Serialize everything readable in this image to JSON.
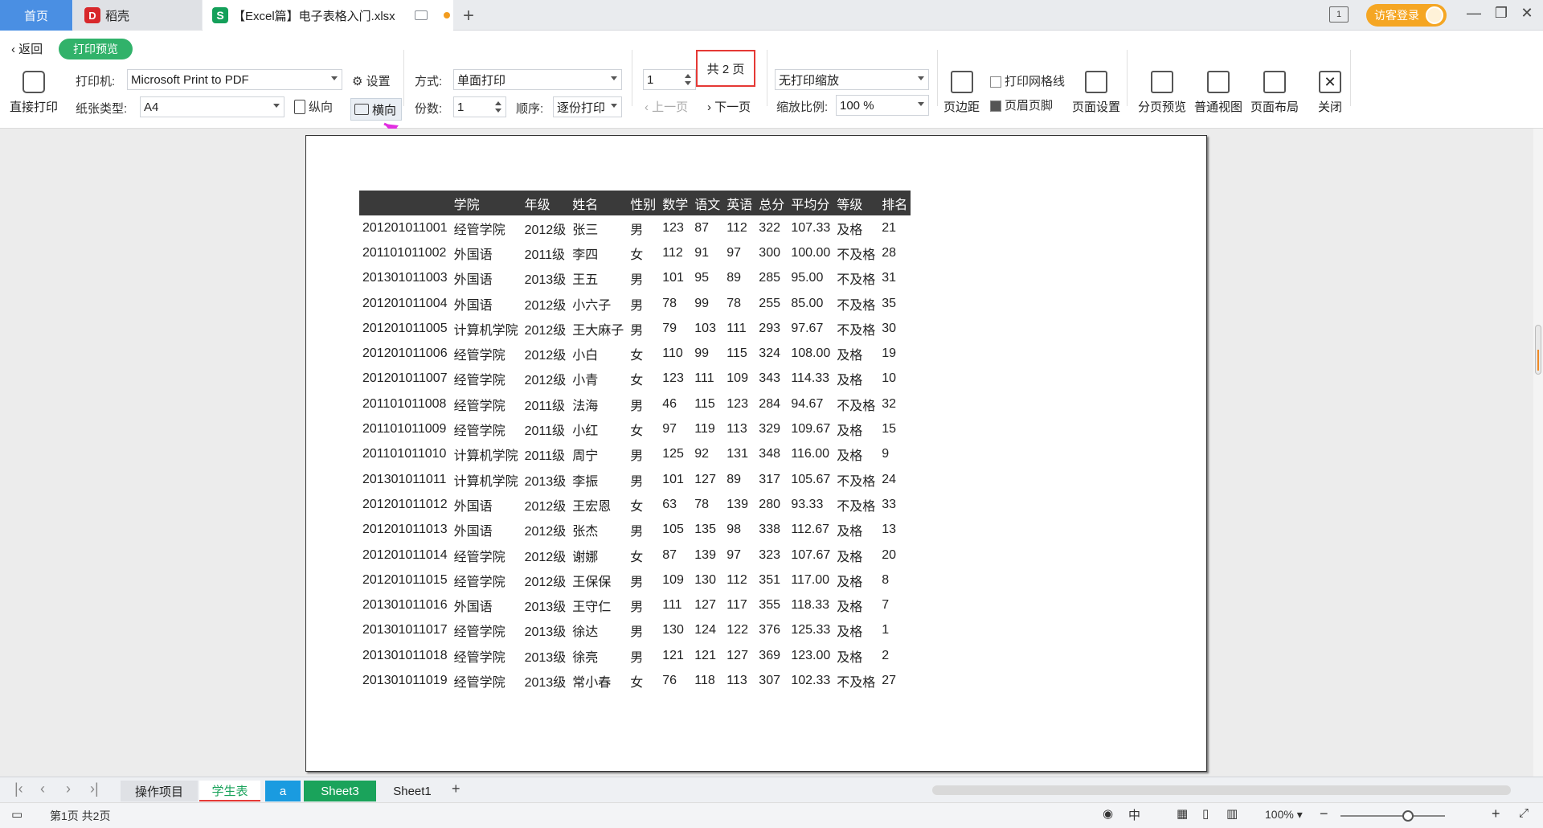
{
  "titlebar": {
    "tabs": [
      {
        "label": "首页"
      },
      {
        "label": "稻壳"
      },
      {
        "label": "【Excel篇】电子表格入门.xlsx"
      }
    ],
    "badge": "1",
    "login": "访客登录"
  },
  "toolbar": {
    "back": "返回",
    "preview": "打印预览",
    "direct_print": "直接打印",
    "printer_label": "打印机:",
    "printer_value": "Microsoft Print to PDF",
    "settings": "设置",
    "paper_label": "纸张类型:",
    "paper_value": "A4",
    "portrait": "纵向",
    "landscape": "横向",
    "mode_label": "方式:",
    "mode_value": "单面打印",
    "copies_label": "份数:",
    "copies_value": "1",
    "order_label": "顺序:",
    "order_value": "逐份打印",
    "page_value": "1",
    "page_count": "共 2 页",
    "prev_page": "上一页",
    "next_page": "下一页",
    "scale_mode": "无打印缩放",
    "scale_label": "缩放比例:",
    "scale_value": "100 %",
    "margins": "页边距",
    "gridlines": "打印网格线",
    "header_footer": "页眉页脚",
    "page_setup": "页面设置",
    "page_break": "分页预览",
    "normal_view": "普通视图",
    "page_layout": "页面布局",
    "close": "关闭"
  },
  "table": {
    "headers": [
      "",
      "学院",
      "年级",
      "姓名",
      "性别",
      "数学",
      "语文",
      "英语",
      "总分",
      "平均分",
      "等级",
      "排名"
    ],
    "rows": [
      [
        "201201011001",
        "经管学院",
        "2012级",
        "张三",
        "男",
        "123",
        "87",
        "112",
        "322",
        "107.33",
        "及格",
        "21"
      ],
      [
        "201101011002",
        "外国语",
        "2011级",
        "李四",
        "女",
        "112",
        "91",
        "97",
        "300",
        "100.00",
        "不及格",
        "28"
      ],
      [
        "201301011003",
        "外国语",
        "2013级",
        "王五",
        "男",
        "101",
        "95",
        "89",
        "285",
        "95.00",
        "不及格",
        "31"
      ],
      [
        "201201011004",
        "外国语",
        "2012级",
        "小六子",
        "男",
        "78",
        "99",
        "78",
        "255",
        "85.00",
        "不及格",
        "35"
      ],
      [
        "201201011005",
        "计算机学院",
        "2012级",
        "王大麻子",
        "男",
        "79",
        "103",
        "111",
        "293",
        "97.67",
        "不及格",
        "30"
      ],
      [
        "201201011006",
        "经管学院",
        "2012级",
        "小白",
        "女",
        "110",
        "99",
        "115",
        "324",
        "108.00",
        "及格",
        "19"
      ],
      [
        "201201011007",
        "经管学院",
        "2012级",
        "小青",
        "女",
        "123",
        "111",
        "109",
        "343",
        "114.33",
        "及格",
        "10"
      ],
      [
        "201101011008",
        "经管学院",
        "2011级",
        "法海",
        "男",
        "46",
        "115",
        "123",
        "284",
        "94.67",
        "不及格",
        "32"
      ],
      [
        "201101011009",
        "经管学院",
        "2011级",
        "小红",
        "女",
        "97",
        "119",
        "113",
        "329",
        "109.67",
        "及格",
        "15"
      ],
      [
        "201101011010",
        "计算机学院",
        "2011级",
        "周宁",
        "男",
        "125",
        "92",
        "131",
        "348",
        "116.00",
        "及格",
        "9"
      ],
      [
        "201301011011",
        "计算机学院",
        "2013级",
        "李振",
        "男",
        "101",
        "127",
        "89",
        "317",
        "105.67",
        "不及格",
        "24"
      ],
      [
        "201201011012",
        "外国语",
        "2012级",
        "王宏恩",
        "女",
        "63",
        "78",
        "139",
        "280",
        "93.33",
        "不及格",
        "33"
      ],
      [
        "201201011013",
        "外国语",
        "2012级",
        "张杰",
        "男",
        "105",
        "135",
        "98",
        "338",
        "112.67",
        "及格",
        "13"
      ],
      [
        "201201011014",
        "经管学院",
        "2012级",
        "谢娜",
        "女",
        "87",
        "139",
        "97",
        "323",
        "107.67",
        "及格",
        "20"
      ],
      [
        "201201011015",
        "经管学院",
        "2012级",
        "王保保",
        "男",
        "109",
        "130",
        "112",
        "351",
        "117.00",
        "及格",
        "8"
      ],
      [
        "201301011016",
        "外国语",
        "2013级",
        "王守仁",
        "男",
        "111",
        "127",
        "117",
        "355",
        "118.33",
        "及格",
        "7"
      ],
      [
        "201301011017",
        "经管学院",
        "2013级",
        "徐达",
        "男",
        "130",
        "124",
        "122",
        "376",
        "125.33",
        "及格",
        "1"
      ],
      [
        "201301011018",
        "经管学院",
        "2013级",
        "徐亮",
        "男",
        "121",
        "121",
        "127",
        "369",
        "123.00",
        "及格",
        "2"
      ],
      [
        "201301011019",
        "经管学院",
        "2013级",
        "常小春",
        "女",
        "76",
        "118",
        "113",
        "307",
        "102.33",
        "不及格",
        "27"
      ]
    ]
  },
  "sheets": [
    {
      "label": "操作项目",
      "bg": "#dfe1e5",
      "color": "#222"
    },
    {
      "label": "学生表",
      "bg": "#ffffff",
      "color": "#1aa35b"
    },
    {
      "label": "a",
      "bg": "#1a9be0",
      "color": "#ffffff"
    },
    {
      "label": "Sheet3",
      "bg": "#1aa35b",
      "color": "#ffffff"
    },
    {
      "label": "Sheet1",
      "bg": "#eef0f3",
      "color": "#222"
    }
  ],
  "status": {
    "page_info": "第1页 共2页",
    "zoom": "100%"
  }
}
